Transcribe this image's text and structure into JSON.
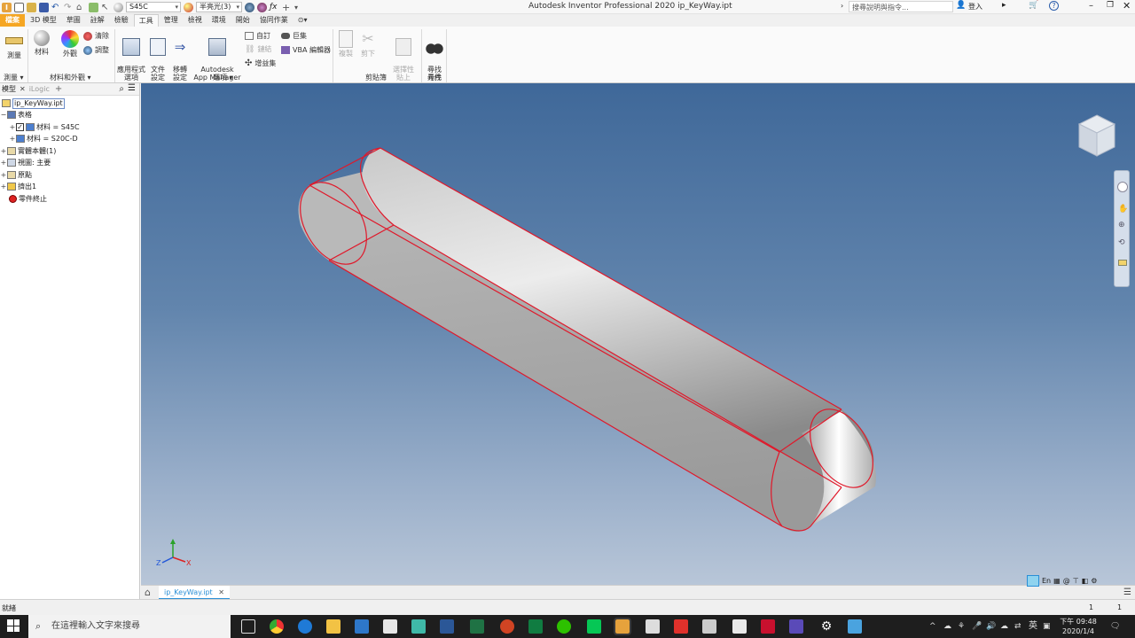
{
  "app": {
    "title": "Autodesk Inventor Professional 2020   ip_KeyWay.ipt",
    "search_placeholder": "搜尋說明與指令...",
    "sign_in": "登入"
  },
  "qat": {
    "material_combo": "S45C",
    "appearance_combo": "半亮光(3)"
  },
  "tabs": [
    {
      "label": "檔案"
    },
    {
      "label": "3D 模型"
    },
    {
      "label": "草圖"
    },
    {
      "label": "註解"
    },
    {
      "label": "檢驗"
    },
    {
      "label": "工具"
    },
    {
      "label": "管理"
    },
    {
      "label": "檢視"
    },
    {
      "label": "環境"
    },
    {
      "label": "開始"
    },
    {
      "label": "協同作業"
    }
  ],
  "ribbon": {
    "measure": "測量",
    "material": "材料",
    "appearance": "外觀",
    "clear": "清除",
    "adjust": "調整",
    "app_options": "應用程式\n選項",
    "doc_settings": "文件\n設定",
    "migrate_settings": "移轉\n設定",
    "app_manager": "Autodesk\nApp Manager",
    "custom": "自訂",
    "macro": "巨集",
    "addins": "增益集",
    "vba_editor": "VBA 編輯器",
    "link": "鏈結",
    "copy": "複製",
    "cut": "剪下",
    "paste_selected": "選擇性\n貼上",
    "find_component": "尋找\n元件",
    "groups": {
      "measure": "測量",
      "material_appearance": "材料和外觀",
      "options": "選項",
      "clipboard": "剪貼簿",
      "find": "尋找"
    }
  },
  "browser": {
    "tab_model": "模型",
    "tab_logic": "iLogic",
    "items": [
      {
        "label": "ip_KeyWay.ipt",
        "level": 0
      },
      {
        "label": "表格",
        "level": 0
      },
      {
        "label": "材料 = S45C",
        "level": 1
      },
      {
        "label": "材料 = S20C-D",
        "level": 1
      },
      {
        "label": "實體本體(1)",
        "level": 0
      },
      {
        "label": "視圖: 主要",
        "level": 0
      },
      {
        "label": "原點",
        "level": 0
      },
      {
        "label": "擠出1",
        "level": 0
      },
      {
        "label": "零件終止",
        "level": 0
      }
    ]
  },
  "document_tab": "ip_KeyWay.ipt",
  "status": {
    "left": "就緒",
    "count1": "1",
    "count2": "1",
    "lang": "En"
  },
  "taskbar": {
    "search": "在這裡輸入文字來搜尋",
    "ime": "英",
    "time": "下午 09:48",
    "date": "2020/1/4"
  },
  "triad": {
    "x": "X",
    "y": "Y",
    "z": "Z"
  },
  "colors": {
    "file_tab": "#f5a623",
    "edge": "#e0182a",
    "accent": "#2a8fd6"
  }
}
